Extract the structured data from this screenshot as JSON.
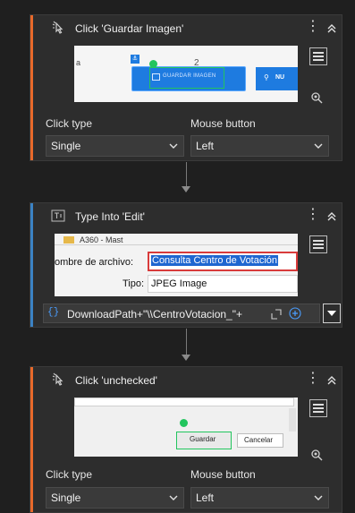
{
  "colors": {
    "click_accent": "#e8692a",
    "type_accent": "#3b82c4",
    "app_blue": "#1e7be0",
    "highlight_green": "#22c55e"
  },
  "activities": [
    {
      "title": "Click 'Guardar Imagen'",
      "icon": "click-icon",
      "screenshot": {
        "anchor_num": "2",
        "button_label": "GUARDAR IMAGEN",
        "right_button": "NU",
        "left_fragment": "a"
      },
      "click_type_label": "Click type",
      "click_type_value": "Single",
      "mouse_button_label": "Mouse button",
      "mouse_button_value": "Left"
    },
    {
      "title": "Type Into 'Edit'",
      "icon": "type-into-icon",
      "screenshot": {
        "top_fragment": "A360 - Mast",
        "filename_label": "ombre de archivo:",
        "filename_value": "Consulta Centro de Votación",
        "type_label": "Tipo:",
        "type_value": "JPEG Image"
      },
      "expression": "DownloadPath+\"\\\\CentroVotacion_\"+"
    },
    {
      "title": "Click 'unchecked'",
      "icon": "click-icon",
      "screenshot": {
        "save_button": "Guardar",
        "cancel_button": "Cancelar"
      },
      "click_type_label": "Click type",
      "click_type_value": "Single",
      "mouse_button_label": "Mouse button",
      "mouse_button_value": "Left"
    }
  ]
}
